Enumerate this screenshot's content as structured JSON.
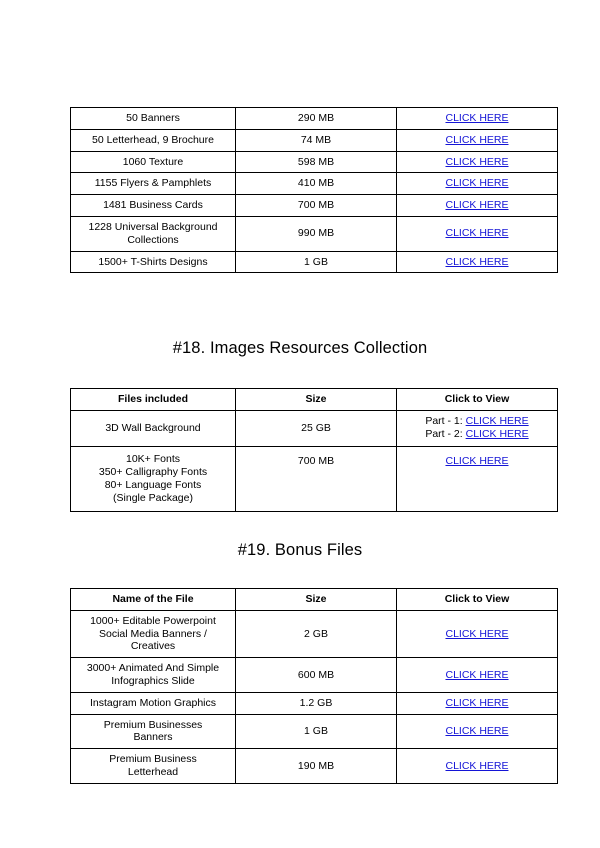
{
  "document": {
    "table_top": {
      "rows": [
        {
          "name": "50 Banners",
          "size": "290 MB",
          "link": "CLICK HERE"
        },
        {
          "name": "50 Letterhead, 9 Brochure",
          "size": "74 MB",
          "link": "CLICK HERE"
        },
        {
          "name": "1060 Texture",
          "size": "598 MB",
          "link": "CLICK HERE"
        },
        {
          "name": "1155 Flyers & Pamphlets",
          "size": "410 MB",
          "link": "CLICK HERE"
        },
        {
          "name": "1481 Business Cards",
          "size": "700 MB",
          "link": "CLICK HERE"
        },
        {
          "name": "1228 Universal Background\nCollections",
          "size": "990 MB",
          "link": "CLICK HERE"
        },
        {
          "name": "1500+ T-Shirts Designs",
          "size": "1 GB",
          "link": "CLICK HERE"
        }
      ]
    },
    "section_18": {
      "title": "#18. Images Resources Collection",
      "headers": {
        "name": "Files included",
        "size": "Size",
        "link": "Click to View"
      },
      "rows": [
        {
          "name": "3D Wall Background",
          "size": "25 GB",
          "parts": [
            {
              "label": "Part - 1:",
              "link": "CLICK HERE"
            },
            {
              "label": "Part - 2:",
              "link": "CLICK HERE"
            }
          ]
        },
        {
          "name": "10K+ Fonts\n350+ Calligraphy Fonts\n80+ Language Fonts\n(Single Package)",
          "size": "700 MB",
          "link": "CLICK HERE"
        }
      ]
    },
    "section_19": {
      "title": "#19. Bonus Files",
      "headers": {
        "name": "Name of the File",
        "size": "Size",
        "link": "Click to View"
      },
      "rows": [
        {
          "name": "1000+ Editable Powerpoint\nSocial Media Banners /\nCreatives",
          "size": "2 GB",
          "link": "CLICK HERE"
        },
        {
          "name": "3000+ Animated And Simple\nInfographics Slide",
          "size": "600 MB",
          "link": "CLICK HERE"
        },
        {
          "name": "Instagram Motion Graphics",
          "size": "1.2 GB",
          "link": "CLICK HERE"
        },
        {
          "name": "Premium Businesses\nBanners",
          "size": "1 GB",
          "link": "CLICK HERE"
        },
        {
          "name": "Premium Business\nLetterhead",
          "size": "190 MB",
          "link": "CLICK HERE"
        }
      ]
    },
    "colors": {
      "link": "#1414d6",
      "border": "#000000",
      "background": "#ffffff"
    }
  }
}
